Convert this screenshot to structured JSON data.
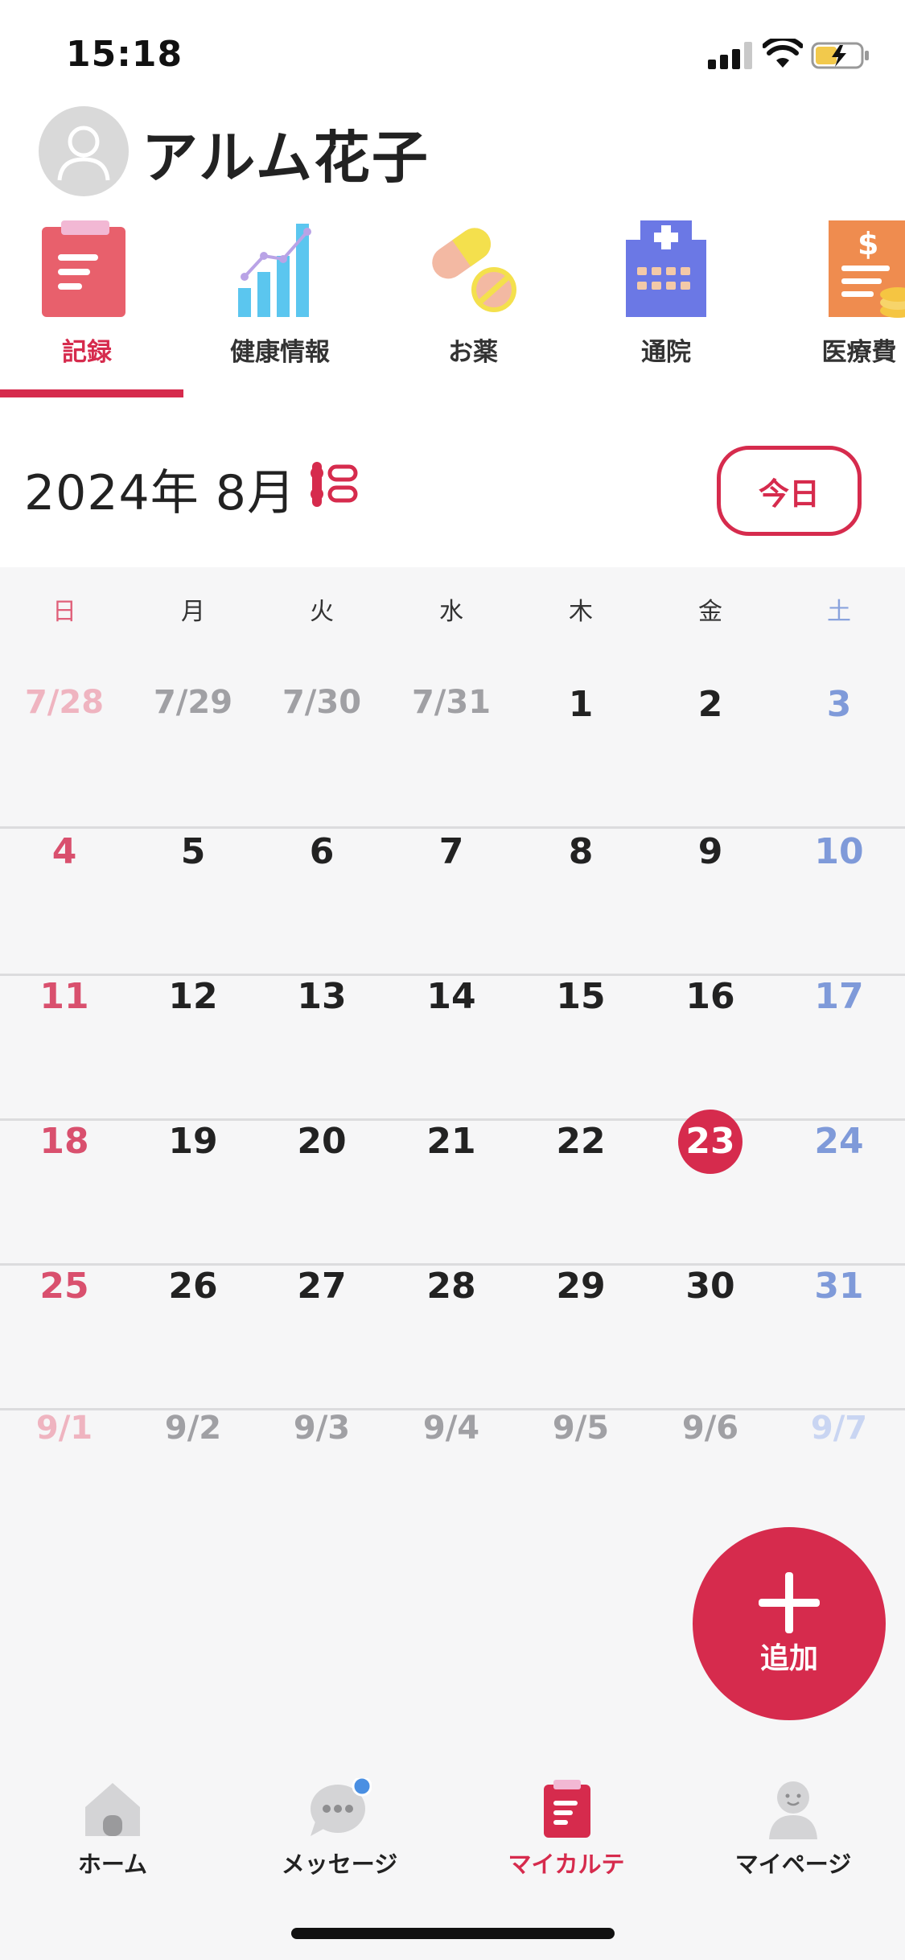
{
  "status_bar": {
    "time": "15:18"
  },
  "profile": {
    "name": "アルム花子"
  },
  "tabs": [
    {
      "label": "記録",
      "icon": "clipboard-record-icon",
      "active": true
    },
    {
      "label": "健康情報",
      "icon": "bar-chart-icon",
      "active": false
    },
    {
      "label": "お薬",
      "icon": "pills-icon",
      "active": false
    },
    {
      "label": "通院",
      "icon": "hospital-icon",
      "active": false
    },
    {
      "label": "医療費",
      "icon": "medical-bill-icon",
      "active": false
    }
  ],
  "calendar": {
    "month_title": "2024年 8月",
    "today_label": "今日",
    "weekdays": [
      "日",
      "月",
      "火",
      "水",
      "木",
      "金",
      "土"
    ],
    "weeks": [
      [
        "7/28",
        "7/29",
        "7/30",
        "7/31",
        "1",
        "2",
        "3"
      ],
      [
        "4",
        "5",
        "6",
        "7",
        "8",
        "9",
        "10"
      ],
      [
        "11",
        "12",
        "13",
        "14",
        "15",
        "16",
        "17"
      ],
      [
        "18",
        "19",
        "20",
        "21",
        "22",
        "23",
        "24"
      ],
      [
        "25",
        "26",
        "27",
        "28",
        "29",
        "30",
        "31"
      ],
      [
        "9/1",
        "9/2",
        "9/3",
        "9/4",
        "9/5",
        "9/6",
        "9/7"
      ]
    ],
    "today": "23"
  },
  "fab": {
    "label": "追加"
  },
  "bottom_nav": [
    {
      "label": "ホーム",
      "icon": "home-icon",
      "active": false
    },
    {
      "label": "メッセージ",
      "icon": "message-icon",
      "active": false,
      "badge": true
    },
    {
      "label": "マイカルテ",
      "icon": "medical-chart-icon",
      "active": true
    },
    {
      "label": "マイページ",
      "icon": "person-icon",
      "active": false
    }
  ],
  "colors": {
    "accent": "#d62b4d",
    "sunday": "#d9506e",
    "saturday": "#7f9ad9",
    "background": "#f6f6f7"
  }
}
